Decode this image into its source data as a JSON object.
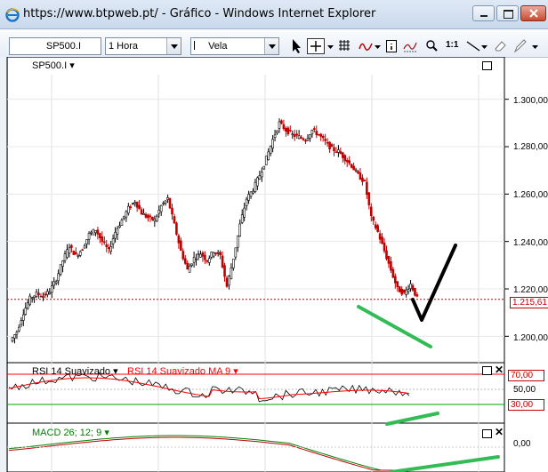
{
  "window": {
    "title": "https://www.btpweb.pt/ - Gráfico - Windows Internet Explorer"
  },
  "toolbar": {
    "symbol_value": "SP500.I",
    "timeframe_value": "1 Hora",
    "chart_style_value": "Vela",
    "zoom_label": "1:1"
  },
  "price_panel": {
    "symbol_label": "SP500.I ▾",
    "y_ticks": [
      "1.300,00",
      "1.280,00",
      "1.260,00",
      "1.240,00",
      "1.220,00",
      "1.200,00"
    ],
    "current_price": "1.215,61"
  },
  "rsi_panel": {
    "label_main": "RSI 14 Suavizado ▾",
    "label_ma": "RSI 14 Suavizado MA 9 ▾",
    "y_ticks": [
      "70,00",
      "50,00",
      "30,00"
    ]
  },
  "macd_panel": {
    "label": "MACD 26; 12; 9 ▾",
    "y_ticks": [
      "0,00"
    ]
  },
  "colors": {
    "up_candle": "#000000",
    "down_candle": "#c00000",
    "rsi_line": "#000000",
    "ma_line": "#ff0000",
    "level_70": "#ff0000",
    "level_30": "#00a000",
    "macd_line": "#008000",
    "signal_line": "#c00000",
    "annotation_green": "#33bb55",
    "annotation_black": "#000000"
  },
  "chart_data": {
    "type": "candlestick",
    "series": [
      {
        "name": "SP500.I",
        "close": [
          1202,
          1210,
          1216,
          1218,
          1217,
          1219,
          1224,
          1232,
          1238,
          1234,
          1237,
          1243,
          1245,
          1240,
          1236,
          1244,
          1249,
          1254,
          1257,
          1252,
          1250,
          1249,
          1255,
          1258,
          1247,
          1236,
          1228,
          1233,
          1235,
          1232,
          1236,
          1234,
          1221,
          1233,
          1247,
          1258,
          1262,
          1268,
          1275,
          1283,
          1290,
          1287,
          1285,
          1284,
          1283,
          1287,
          1285,
          1282,
          1279,
          1278,
          1275,
          1272,
          1268,
          1265,
          1250,
          1244,
          1236,
          1228,
          1220,
          1218,
          1222,
          1216
        ]
      }
    ],
    "ylim": [
      1190,
      1310
    ]
  }
}
